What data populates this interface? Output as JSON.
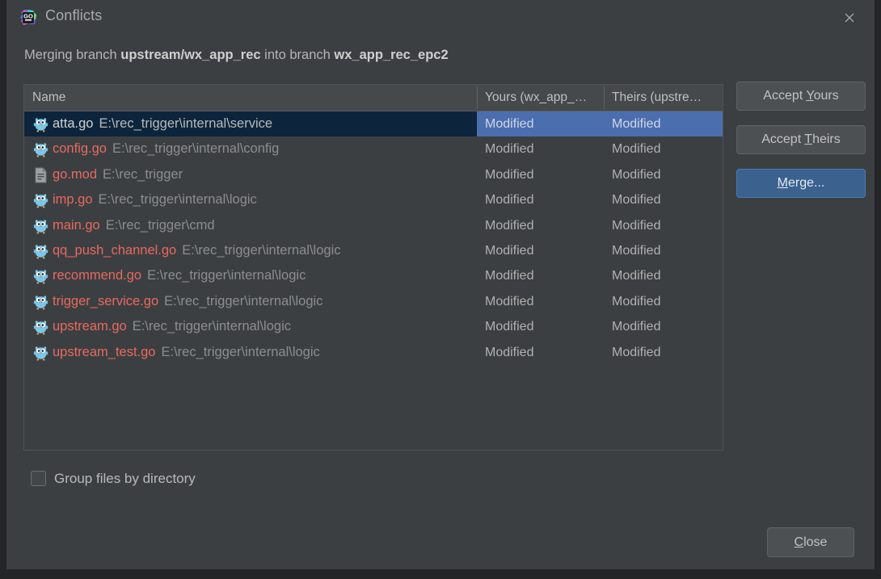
{
  "window": {
    "title": "Conflicts",
    "app_icon": "goland-icon",
    "close_icon": "close-icon"
  },
  "subtitle": {
    "prefix": "Merging branch ",
    "source_branch": "upstream/wx_app_rec",
    "middle": " into branch ",
    "target_branch": "wx_app_rec_epc2"
  },
  "table": {
    "columns": [
      {
        "key": "name",
        "label": "Name"
      },
      {
        "key": "yours",
        "label": "Yours (wx_app_…"
      },
      {
        "key": "theirs",
        "label": "Theirs (upstre…"
      }
    ],
    "rows": [
      {
        "icon": "go-gopher-icon",
        "name": "atta.go",
        "path": "E:\\rec_trigger\\internal\\service",
        "yours": "Modified",
        "theirs": "Modified",
        "selected": true
      },
      {
        "icon": "go-gopher-icon",
        "name": "config.go",
        "path": "E:\\rec_trigger\\internal\\config",
        "yours": "Modified",
        "theirs": "Modified",
        "selected": false
      },
      {
        "icon": "file-document-icon",
        "name": "go.mod",
        "path": "E:\\rec_trigger",
        "yours": "Modified",
        "theirs": "Modified",
        "selected": false
      },
      {
        "icon": "go-gopher-icon",
        "name": "imp.go",
        "path": "E:\\rec_trigger\\internal\\logic",
        "yours": "Modified",
        "theirs": "Modified",
        "selected": false
      },
      {
        "icon": "go-gopher-icon",
        "name": "main.go",
        "path": "E:\\rec_trigger\\cmd",
        "yours": "Modified",
        "theirs": "Modified",
        "selected": false
      },
      {
        "icon": "go-gopher-icon",
        "name": "qq_push_channel.go",
        "path": "E:\\rec_trigger\\internal\\logic",
        "yours": "Modified",
        "theirs": "Modified",
        "selected": false
      },
      {
        "icon": "go-gopher-icon",
        "name": "recommend.go",
        "path": "E:\\rec_trigger\\internal\\logic",
        "yours": "Modified",
        "theirs": "Modified",
        "selected": false
      },
      {
        "icon": "go-gopher-icon",
        "name": "trigger_service.go",
        "path": "E:\\rec_trigger\\internal\\logic",
        "yours": "Modified",
        "theirs": "Modified",
        "selected": false
      },
      {
        "icon": "go-gopher-icon",
        "name": "upstream.go",
        "path": "E:\\rec_trigger\\internal\\logic",
        "yours": "Modified",
        "theirs": "Modified",
        "selected": false
      },
      {
        "icon": "go-gopher-icon",
        "name": "upstream_test.go",
        "path": "E:\\rec_trigger\\internal\\logic",
        "yours": "Modified",
        "theirs": "Modified",
        "selected": false
      }
    ]
  },
  "side_buttons": {
    "accept_yours": {
      "before": "Accept ",
      "mnemonic": "Y",
      "after": "ours"
    },
    "accept_theirs": {
      "before": "Accept ",
      "mnemonic": "T",
      "after": "heirs"
    },
    "merge": {
      "before": "",
      "mnemonic": "M",
      "after": "erge..."
    }
  },
  "group_checkbox": {
    "label": "Group files by directory",
    "checked": false
  },
  "close_button": {
    "before": "",
    "mnemonic": "C",
    "after": "lose"
  },
  "colors": {
    "background": "#3c3f41",
    "selection_blue": "#4b6eaf",
    "selection_name_bg": "#0d253c",
    "filename_red": "#e8695f",
    "path_gray": "#8b8d8e",
    "default_button_blue": "#3b618f",
    "header_bg": "#45494a"
  }
}
